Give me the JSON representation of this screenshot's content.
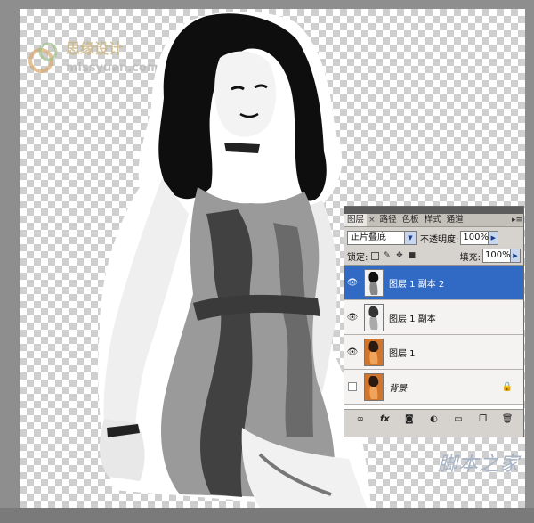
{
  "panel": {
    "tabs": [
      {
        "label": "图层",
        "active": true
      },
      {
        "label": "路径"
      },
      {
        "label": "色板"
      },
      {
        "label": "样式"
      },
      {
        "label": "通道"
      }
    ],
    "tab_close": "×",
    "blend_mode": "正片叠底",
    "opacity_label": "不透明度:",
    "opacity_value": "100%",
    "lock_label": "锁定:",
    "fill_label": "填充:",
    "fill_value": "100%",
    "layers": [
      {
        "name": "图层 1 副本 2",
        "visible": true,
        "selected": true,
        "thumb": "bw"
      },
      {
        "name": "图层 1 副本",
        "visible": true,
        "selected": false,
        "thumb": "bw"
      },
      {
        "name": "图层 1",
        "visible": true,
        "selected": false,
        "thumb": "orange"
      },
      {
        "name": "背景",
        "visible": false,
        "selected": false,
        "thumb": "orange",
        "locked": true
      }
    ],
    "footer_icons": [
      "link-icon",
      "fx-icon",
      "mask-icon",
      "adjustment-icon",
      "folder-icon",
      "new-layer-icon",
      "trash-icon"
    ]
  },
  "watermark_logo": {
    "line1": "思缘设计",
    "line2": "missyuan.com"
  },
  "site_watermark": "脚本之家",
  "colors": {
    "canvas_bg": "#8e8e8e",
    "selection": "#316ac5",
    "watermark": "#a7b4c6"
  }
}
